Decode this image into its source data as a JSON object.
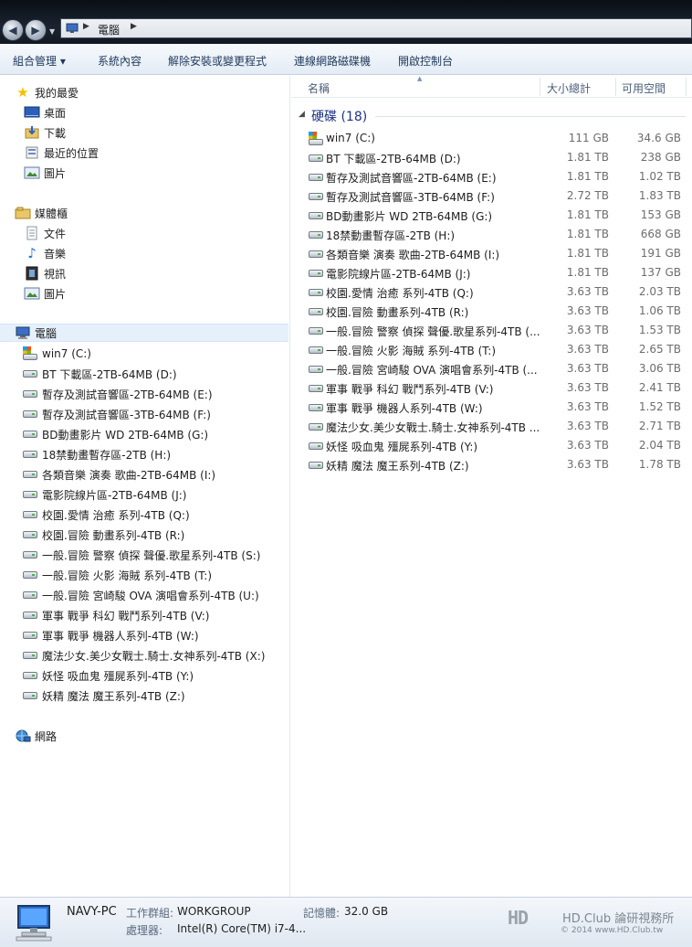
{
  "address": {
    "crumb": "電腦"
  },
  "toolbar": {
    "organize": "組合管理 ▾",
    "system_props": "系統內容",
    "uninstall": "解除安裝或變更程式",
    "map_drive": "連線網路磁碟機",
    "control_panel": "開啟控制台"
  },
  "nav": {
    "favorites": {
      "label": "我的最愛",
      "items": [
        {
          "label": "桌面",
          "icon": "desktop-icon"
        },
        {
          "label": "下載",
          "icon": "downloads-icon"
        },
        {
          "label": "最近的位置",
          "icon": "recent-places-icon"
        },
        {
          "label": "圖片",
          "icon": "pictures-icon"
        }
      ]
    },
    "libraries": {
      "label": "媒體櫃",
      "items": [
        {
          "label": "文件",
          "icon": "documents-icon"
        },
        {
          "label": "音樂",
          "icon": "music-icon"
        },
        {
          "label": "視訊",
          "icon": "videos-icon"
        },
        {
          "label": "圖片",
          "icon": "pictures-icon"
        }
      ]
    },
    "computer": {
      "label": "電腦",
      "items": [
        "win7 (C:)",
        "BT 下載區-2TB-64MB (D:)",
        " 暫存及測試音響區-2TB-64MB (E:)",
        " 暫存及測試音響區-3TB-64MB (F:)",
        "BD動畫影片 WD 2TB-64MB (G:)",
        "18禁動畫暫存區-2TB (H:)",
        "各類音樂 演奏 歌曲-2TB-64MB (I:)",
        "電影院線片區-2TB-64MB (J:)",
        "校園.愛情 治癒 系列-4TB (Q:)",
        "校園.冒險 動畫系列-4TB (R:)",
        "一般.冒險 警察 偵探 聲優.歌星系列-4TB (S:)",
        "一般.冒險 火影 海賊 系列-4TB (T:)",
        "一般.冒險 宮崎駿 OVA 演唱會系列-4TB (U:)",
        "軍事 戰爭 科幻 戰鬥系列-4TB (V:)",
        "軍事 戰爭 機器人系列-4TB (W:)",
        "魔法少女.美少女戰士.騎士.女神系列-4TB (X:)",
        "妖怪 吸血鬼 殭屍系列-4TB (Y:)",
        "妖精 魔法 魔王系列-4TB (Z:)"
      ]
    },
    "network": {
      "label": "網路"
    }
  },
  "columns": {
    "name": "名稱",
    "total": "大小總計",
    "free": "可用空間"
  },
  "group": {
    "label": "硬碟 (18)"
  },
  "drives": [
    {
      "name": "win7 (C:)",
      "total": "111 GB",
      "free": "34.6 GB",
      "system": true
    },
    {
      "name": "BT 下載區-2TB-64MB (D:)",
      "total": "1.81 TB",
      "free": "238 GB"
    },
    {
      "name": " 暫存及測試音響區-2TB-64MB (E:)",
      "total": "1.81 TB",
      "free": "1.02 TB"
    },
    {
      "name": " 暫存及測試音響區-3TB-64MB (F:)",
      "total": "2.72 TB",
      "free": "1.83 TB"
    },
    {
      "name": "BD動畫影片 WD 2TB-64MB (G:)",
      "total": "1.81 TB",
      "free": "153 GB"
    },
    {
      "name": "18禁動畫暫存區-2TB (H:)",
      "total": "1.81 TB",
      "free": "668 GB"
    },
    {
      "name": "各類音樂 演奏 歌曲-2TB-64MB (I:)",
      "total": "1.81 TB",
      "free": "191 GB"
    },
    {
      "name": "電影院線片區-2TB-64MB (J:)",
      "total": "1.81 TB",
      "free": "137 GB"
    },
    {
      "name": "校園.愛情 治癒 系列-4TB (Q:)",
      "total": "3.63 TB",
      "free": "2.03 TB"
    },
    {
      "name": "校園.冒險 動畫系列-4TB (R:)",
      "total": "3.63 TB",
      "free": "1.06 TB"
    },
    {
      "name": "一般.冒險 警察 偵探 聲優.歌星系列-4TB (...",
      "total": "3.63 TB",
      "free": "1.53 TB"
    },
    {
      "name": "一般.冒險 火影 海賊 系列-4TB (T:)",
      "total": "3.63 TB",
      "free": "2.65 TB"
    },
    {
      "name": "一般.冒險 宮崎駿 OVA 演唱會系列-4TB (...",
      "total": "3.63 TB",
      "free": "3.06 TB"
    },
    {
      "name": "軍事 戰爭 科幻 戰鬥系列-4TB (V:)",
      "total": "3.63 TB",
      "free": "2.41 TB"
    },
    {
      "name": "軍事 戰爭 機器人系列-4TB (W:)",
      "total": "3.63 TB",
      "free": "1.52 TB"
    },
    {
      "name": "魔法少女.美少女戰士.騎士.女神系列-4TB ...",
      "total": "3.63 TB",
      "free": "2.71 TB"
    },
    {
      "name": "妖怪 吸血鬼 殭屍系列-4TB (Y:)",
      "total": "3.63 TB",
      "free": "2.04 TB"
    },
    {
      "name": "妖精 魔法 魔王系列-4TB (Z:)",
      "total": "3.63 TB",
      "free": "1.78 TB"
    }
  ],
  "details": {
    "pc_name": "NAVY-PC",
    "workgroup_label": "工作群組:",
    "workgroup": "WORKGROUP",
    "memory_label": "記憶體:",
    "memory": "32.0 GB",
    "cpu_label": "處理器:",
    "cpu": "Intel(R) Core(TM) i7-4..."
  },
  "watermark": {
    "logo": "HD",
    "brand": "HD.Club 論研視務所",
    "copyright": "© 2014 www.HD.Club.tw"
  },
  "colors": {
    "accent": "#1e395b",
    "selection": "#e5f0fb",
    "group_header": "#1e3287"
  }
}
